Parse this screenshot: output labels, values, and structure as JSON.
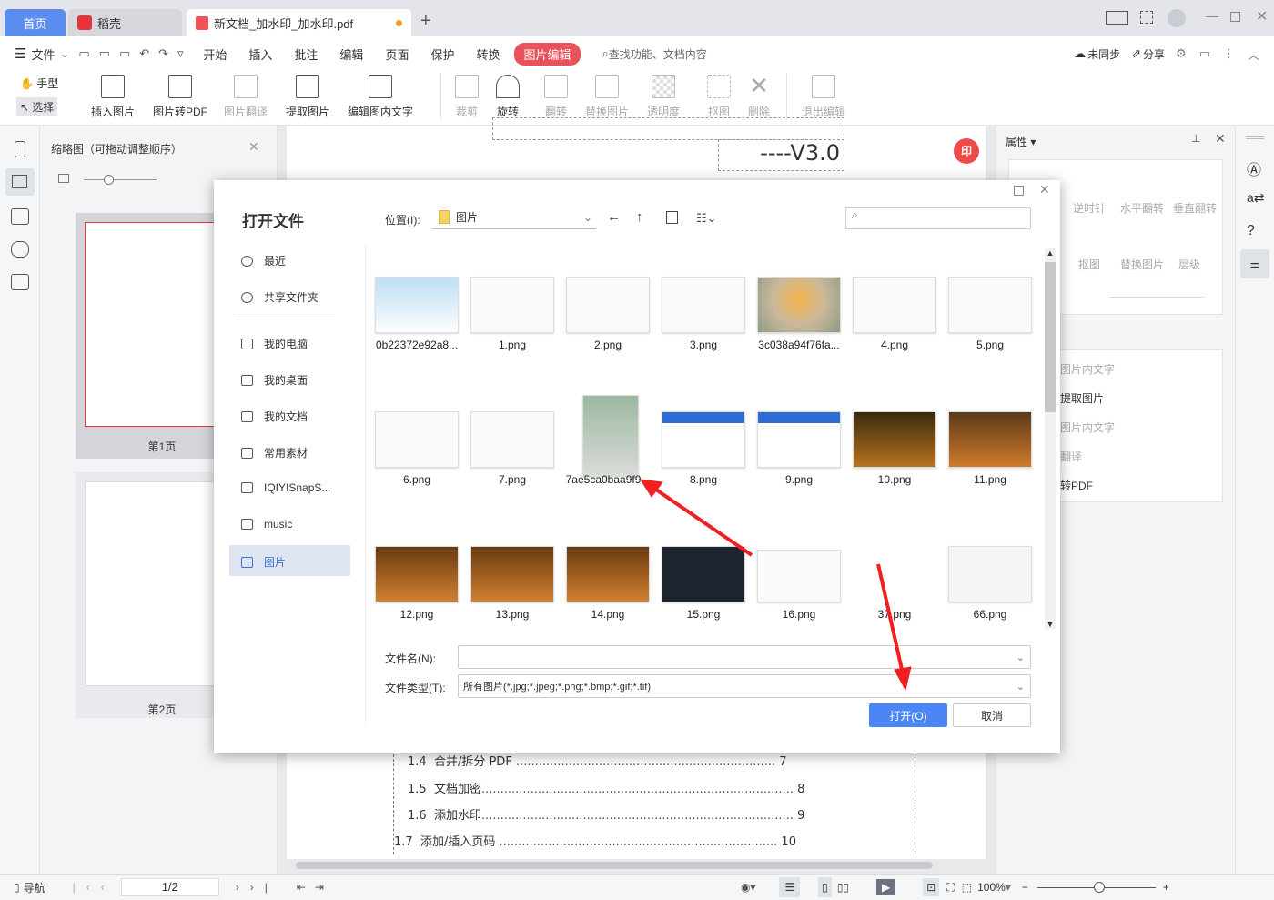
{
  "tabs": [
    {
      "label": "首页"
    },
    {
      "label": "稻壳"
    },
    {
      "label": "新文档_加水印_加水印.pdf"
    }
  ],
  "menu": {
    "file": "文件",
    "items": [
      "开始",
      "插入",
      "批注",
      "编辑",
      "页面",
      "保护",
      "转换"
    ],
    "active": "图片编辑",
    "search": "查找功能、文档内容",
    "sync": "未同步",
    "share": "分享"
  },
  "ribbon": {
    "hand": "手型",
    "select": "选择",
    "tools": [
      {
        "label": "插入图片",
        "enabled": true
      },
      {
        "label": "图片转PDF",
        "enabled": true
      },
      {
        "label": "图片翻译",
        "enabled": false
      },
      {
        "label": "提取图片",
        "enabled": true
      },
      {
        "label": "编辑图内文字",
        "enabled": true
      },
      {
        "label": "裁剪",
        "enabled": false
      },
      {
        "label": "旋转",
        "enabled": true
      },
      {
        "label": "翻转",
        "enabled": false
      },
      {
        "label": "替换图片",
        "enabled": false
      },
      {
        "label": "透明度",
        "enabled": false
      },
      {
        "label": "抠图",
        "enabled": false
      },
      {
        "label": "删除",
        "enabled": false
      },
      {
        "label": "退出编辑",
        "enabled": false
      }
    ]
  },
  "thumbs": {
    "title": "缩略图（可拖动调整顺序）",
    "pages": [
      "第1页",
      "第2页"
    ]
  },
  "doc": {
    "version": "----V3.0",
    "toc": [
      {
        "num": "1.4",
        "text": "合并/拆分  PDF",
        "page": "7"
      },
      {
        "num": "1.5",
        "text": "文档加密",
        "page": "8"
      },
      {
        "num": "1.6",
        "text": "添加水印",
        "page": "9"
      },
      {
        "num": "1.7",
        "text": "添加/插入页码",
        "page": "10"
      }
    ]
  },
  "rightpanel": {
    "title": "属性",
    "tools1": [
      "逆时针",
      "水平翻转",
      "垂直翻转"
    ],
    "tools2": [
      "抠图",
      "替换图片",
      "层级"
    ],
    "list": [
      "图片内文字",
      "提取图片",
      "图片内文字",
      "翻译",
      "转PDF"
    ]
  },
  "dialog": {
    "title": "打开文件",
    "location_label": "位置(I):",
    "location": "图片",
    "sidebar": [
      "最近",
      "共享文件夹",
      "我的电脑",
      "我的桌面",
      "我的文档",
      "常用素材",
      "IQIYISnapS...",
      "music",
      "图片"
    ],
    "selected_sidebar": "图片",
    "files": [
      [
        "0b22372e92a8...",
        "1.png",
        "2.png",
        "3.png",
        "3c038a94f76fa...",
        "4.png",
        "5.png"
      ],
      [
        "6.png",
        "7.png",
        "7ae5ca0baa9f9...",
        "8.png",
        "9.png",
        "10.png",
        "11.png"
      ],
      [
        "12.png",
        "13.png",
        "14.png",
        "15.png",
        "16.png",
        "37.png",
        "66.png"
      ]
    ],
    "filename_label": "文件名(N):",
    "filename": "",
    "filetype_label": "文件类型(T):",
    "filetype": "所有图片(*.jpg;*.jpeg;*.png;*.bmp;*.gif;*.tif)",
    "open": "打开(O)",
    "cancel": "取消"
  },
  "status": {
    "nav": "导航",
    "page": "1/2",
    "zoom": "100%"
  },
  "colors": {
    "accent": "#4a86f5",
    "active_tab": "#e9525a",
    "home_tab": "#5b8def",
    "arrow": "#f02020"
  }
}
